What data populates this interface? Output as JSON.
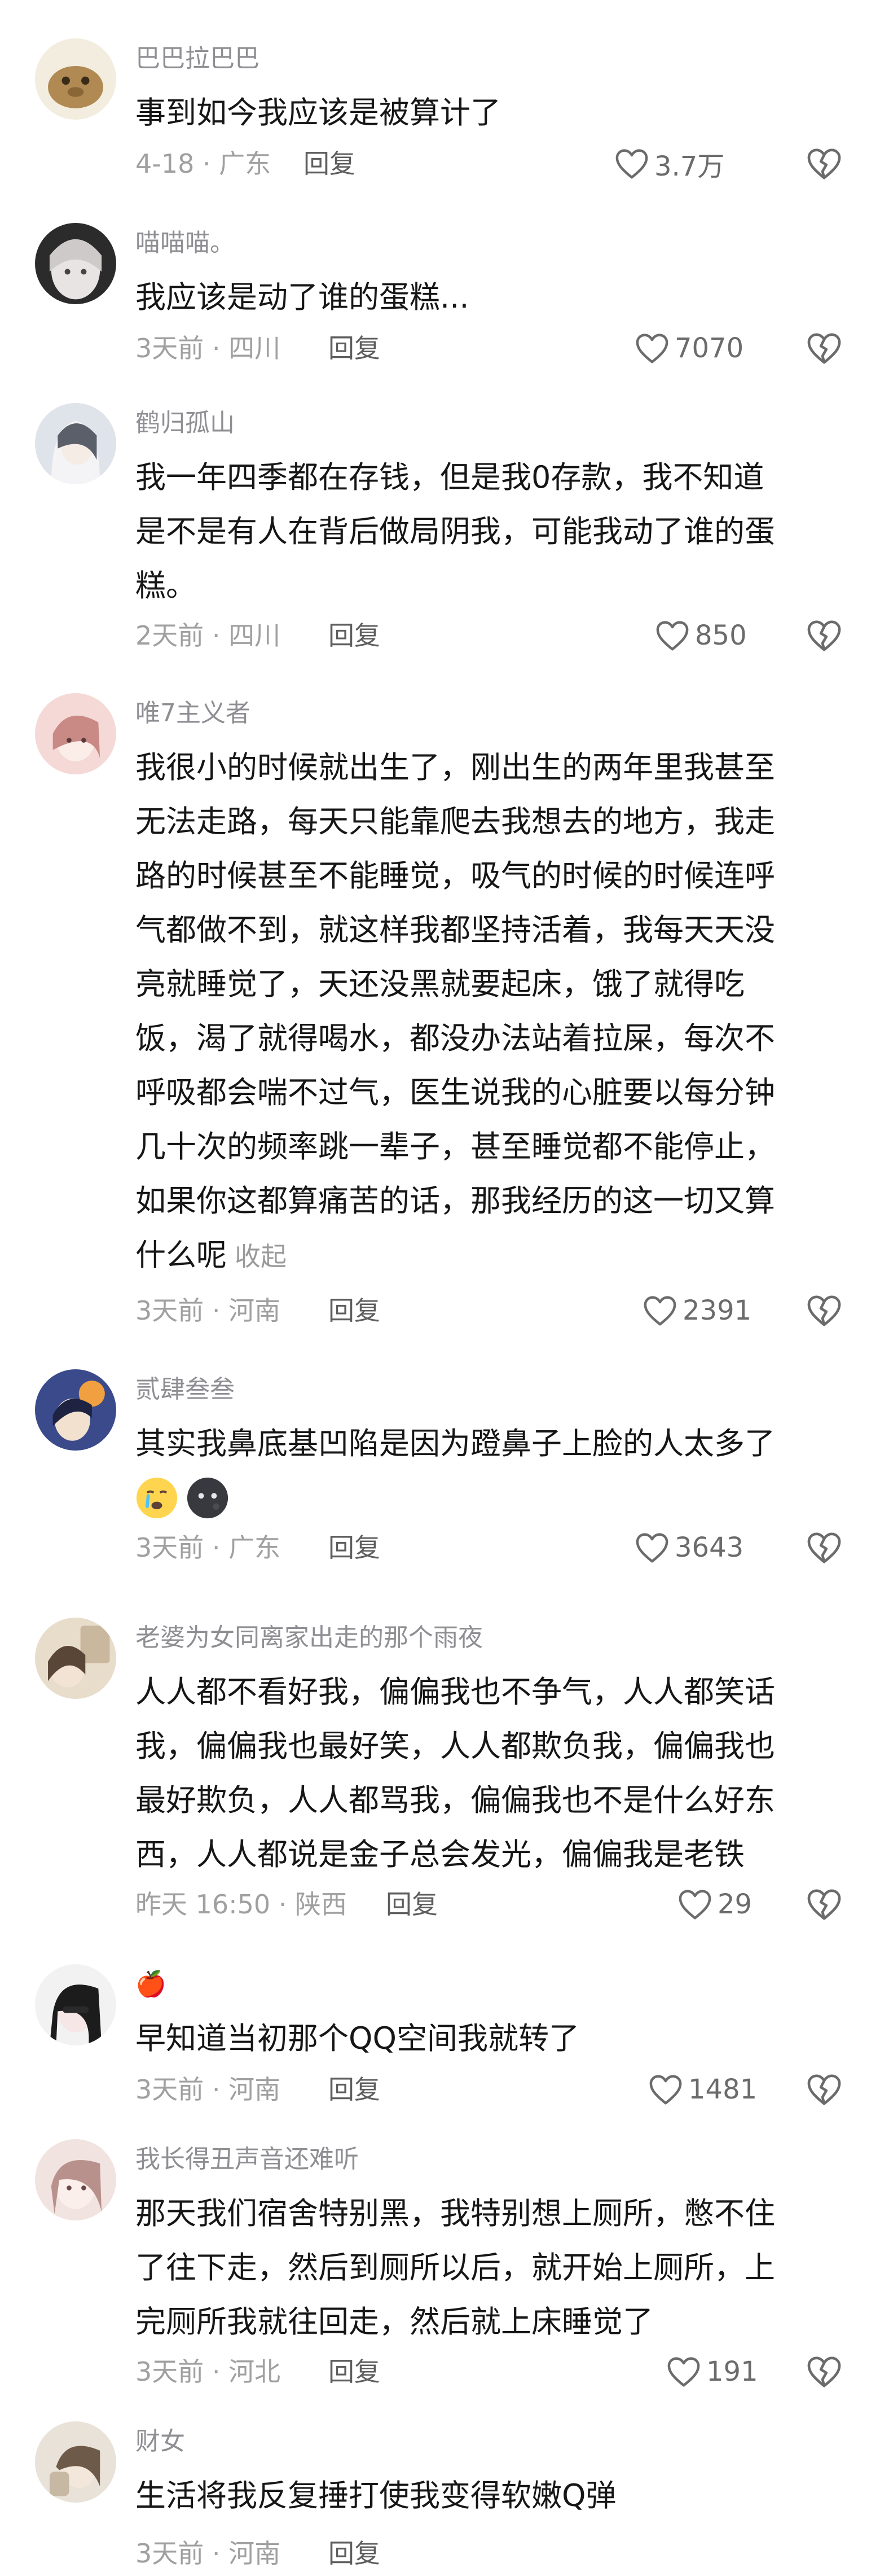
{
  "comments": [
    {
      "username": "巴巴拉巴巴",
      "content_lines": [
        "事到如今我应该是被算计了"
      ],
      "meta": "4-18 · 广东",
      "reply_label": "回复",
      "likes": "3.7万",
      "avatar_colors": [
        "#f3ede0",
        "#b08a52"
      ]
    },
    {
      "username": "喵喵喵。",
      "content_lines": [
        "我应该是动了谁的蛋糕..."
      ],
      "meta": "3天前 · 四川",
      "reply_label": "回复",
      "likes": "7070",
      "avatar_colors": [
        "#2b2b2b",
        "#e8e4e4"
      ]
    },
    {
      "username": "鹤归孤山",
      "content_lines": [
        "我一年四季都在存钱，但是我0存款，我不知道",
        "是不是有人在背后做局阴我，可能我动了谁的蛋",
        "糕。"
      ],
      "meta": "2天前 · 四川",
      "reply_label": "回复",
      "likes": "850",
      "avatar_colors": [
        "#dfe3ea",
        "#5b5f6a"
      ]
    },
    {
      "username": "唯7主义者",
      "content_lines": [
        "我很小的时候就出生了，刚出生的两年里我甚至",
        "无法走路，每天只能靠爬去我想去的地方，我走",
        "路的时候甚至不能睡觉，吸气的时候的时候连呼",
        "气都做不到，就这样我都坚持活着，我每天天没",
        "亮就睡觉了，天还没黑就要起床，饿了就得吃",
        "饭，渴了就得喝水，都没办法站着拉屎，每次不",
        "呼吸都会喘不过气，医生说我的心脏要以每分钟",
        "几十次的频率跳一辈子，甚至睡觉都不能停止，",
        "如果你这都算痛苦的话，那我经历的这一切又算",
        "什么呢"
      ],
      "collapse_label": "收起",
      "meta": "3天前 · 河南",
      "reply_label": "回复",
      "likes": "2391",
      "avatar_colors": [
        "#f4d9d6",
        "#c98a86"
      ]
    },
    {
      "username": "贰肆叁叁",
      "content_lines": [
        "其实我鼻底基凹陷是因为蹬鼻子上脸的人太多了"
      ],
      "emojis": [
        "crying-face-emoji",
        "dark-moon-face-emoji"
      ],
      "meta": "3天前 · 广东",
      "reply_label": "回复",
      "likes": "3643",
      "avatar_colors": [
        "#3a4a8a",
        "#f0a040"
      ]
    },
    {
      "username": "老婆为女同离家出走的那个雨夜",
      "content_lines": [
        "人人都不看好我，偏偏我也不争气，人人都笑话",
        "我，偏偏我也最好笑，人人都欺负我，偏偏我也",
        "最好欺负，人人都骂我，偏偏我也不是什么好东",
        "西，人人都说是金子总会发光，偏偏我是老铁"
      ],
      "meta": "昨天 16:50 · 陕西",
      "reply_label": "回复",
      "likes": "29",
      "avatar_colors": [
        "#e8dccb",
        "#5a4636"
      ]
    },
    {
      "username": "🍎",
      "content_lines": [
        "早知道当初那个QQ空间我就转了"
      ],
      "meta": "3天前 · 河南",
      "reply_label": "回复",
      "likes": "1481",
      "avatar_colors": [
        "#f2f2f2",
        "#1c1c1c"
      ]
    },
    {
      "username": "我长得丑声音还难听",
      "content_lines": [
        "那天我们宿舍特别黑，我特别想上厕所，憋不住",
        "了往下走，然后到厕所以后，就开始上厕所，上",
        "完厕所我就往回走，然后就上床睡觉了"
      ],
      "meta": "3天前 · 河北",
      "reply_label": "回复",
      "likes": "191",
      "avatar_colors": [
        "#f1e3e0",
        "#b9918c"
      ]
    },
    {
      "username": "财女",
      "content_lines": [
        "生活将我反复捶打使我变得软嫩Q弹"
      ],
      "meta": "3天前 · 河南",
      "reply_label": "回复",
      "likes": "",
      "avatar_colors": [
        "#e9e2d8",
        "#6d5a48"
      ]
    }
  ]
}
